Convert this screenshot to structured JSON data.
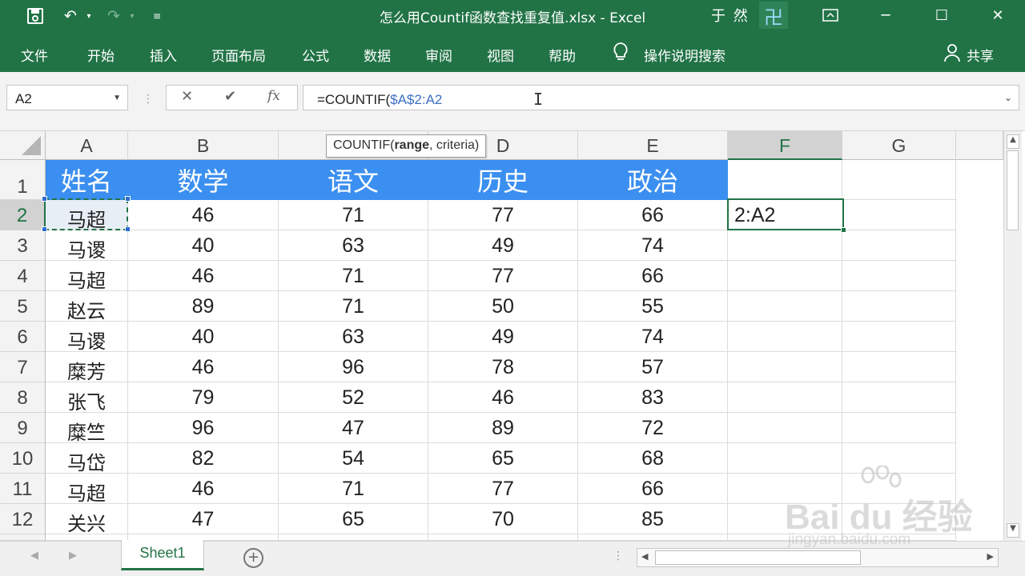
{
  "window": {
    "title": "怎么用Countif函数查找重复值.xlsx  -  Excel",
    "user": "于 然",
    "avatar_text": "卍"
  },
  "ribbon": {
    "tabs": [
      "文件",
      "开始",
      "插入",
      "页面布局",
      "公式",
      "数据",
      "审阅",
      "视图",
      "帮助"
    ],
    "tell_me": "操作说明搜索",
    "share": "共享"
  },
  "formula_bar": {
    "name_box": "A2",
    "formula_prefix": "=COUNTIF(",
    "formula_ref": "$A$2:A2",
    "fx_label": "fx"
  },
  "tooltip": {
    "func": "COUNTIF(",
    "arg_bold": "range",
    "rest": ", criteria)"
  },
  "columns": [
    "A",
    "B",
    "C",
    "D",
    "E",
    "F",
    "G"
  ],
  "rows": [
    "1",
    "2",
    "3",
    "4",
    "5",
    "6",
    "7",
    "8",
    "9",
    "10",
    "11",
    "12"
  ],
  "table": {
    "headers": [
      "姓名",
      "数学",
      "语文",
      "历史",
      "政治"
    ],
    "data": [
      [
        "马超",
        "46",
        "71",
        "77",
        "66"
      ],
      [
        "马谡",
        "40",
        "63",
        "49",
        "74"
      ],
      [
        "马超",
        "46",
        "71",
        "77",
        "66"
      ],
      [
        "赵云",
        "89",
        "71",
        "50",
        "55"
      ],
      [
        "马谡",
        "40",
        "63",
        "49",
        "74"
      ],
      [
        "糜芳",
        "46",
        "96",
        "78",
        "57"
      ],
      [
        "张飞",
        "79",
        "52",
        "46",
        "83"
      ],
      [
        "糜竺",
        "96",
        "47",
        "89",
        "72"
      ],
      [
        "马岱",
        "82",
        "54",
        "65",
        "68"
      ],
      [
        "马超",
        "46",
        "71",
        "77",
        "66"
      ],
      [
        "关兴",
        "47",
        "65",
        "70",
        "85"
      ]
    ]
  },
  "active_cell": {
    "ref": "F2",
    "editing_text": "2:A2"
  },
  "sheets": {
    "tabs": [
      "Sheet1"
    ],
    "active": "Sheet1"
  },
  "watermark": {
    "brand": "Bai du 经验",
    "url": "jingyan.baidu.com"
  },
  "colors": {
    "excel_green": "#217346",
    "header_blue": "#3b8ff0",
    "ref_blue": "#3c6fc4"
  }
}
